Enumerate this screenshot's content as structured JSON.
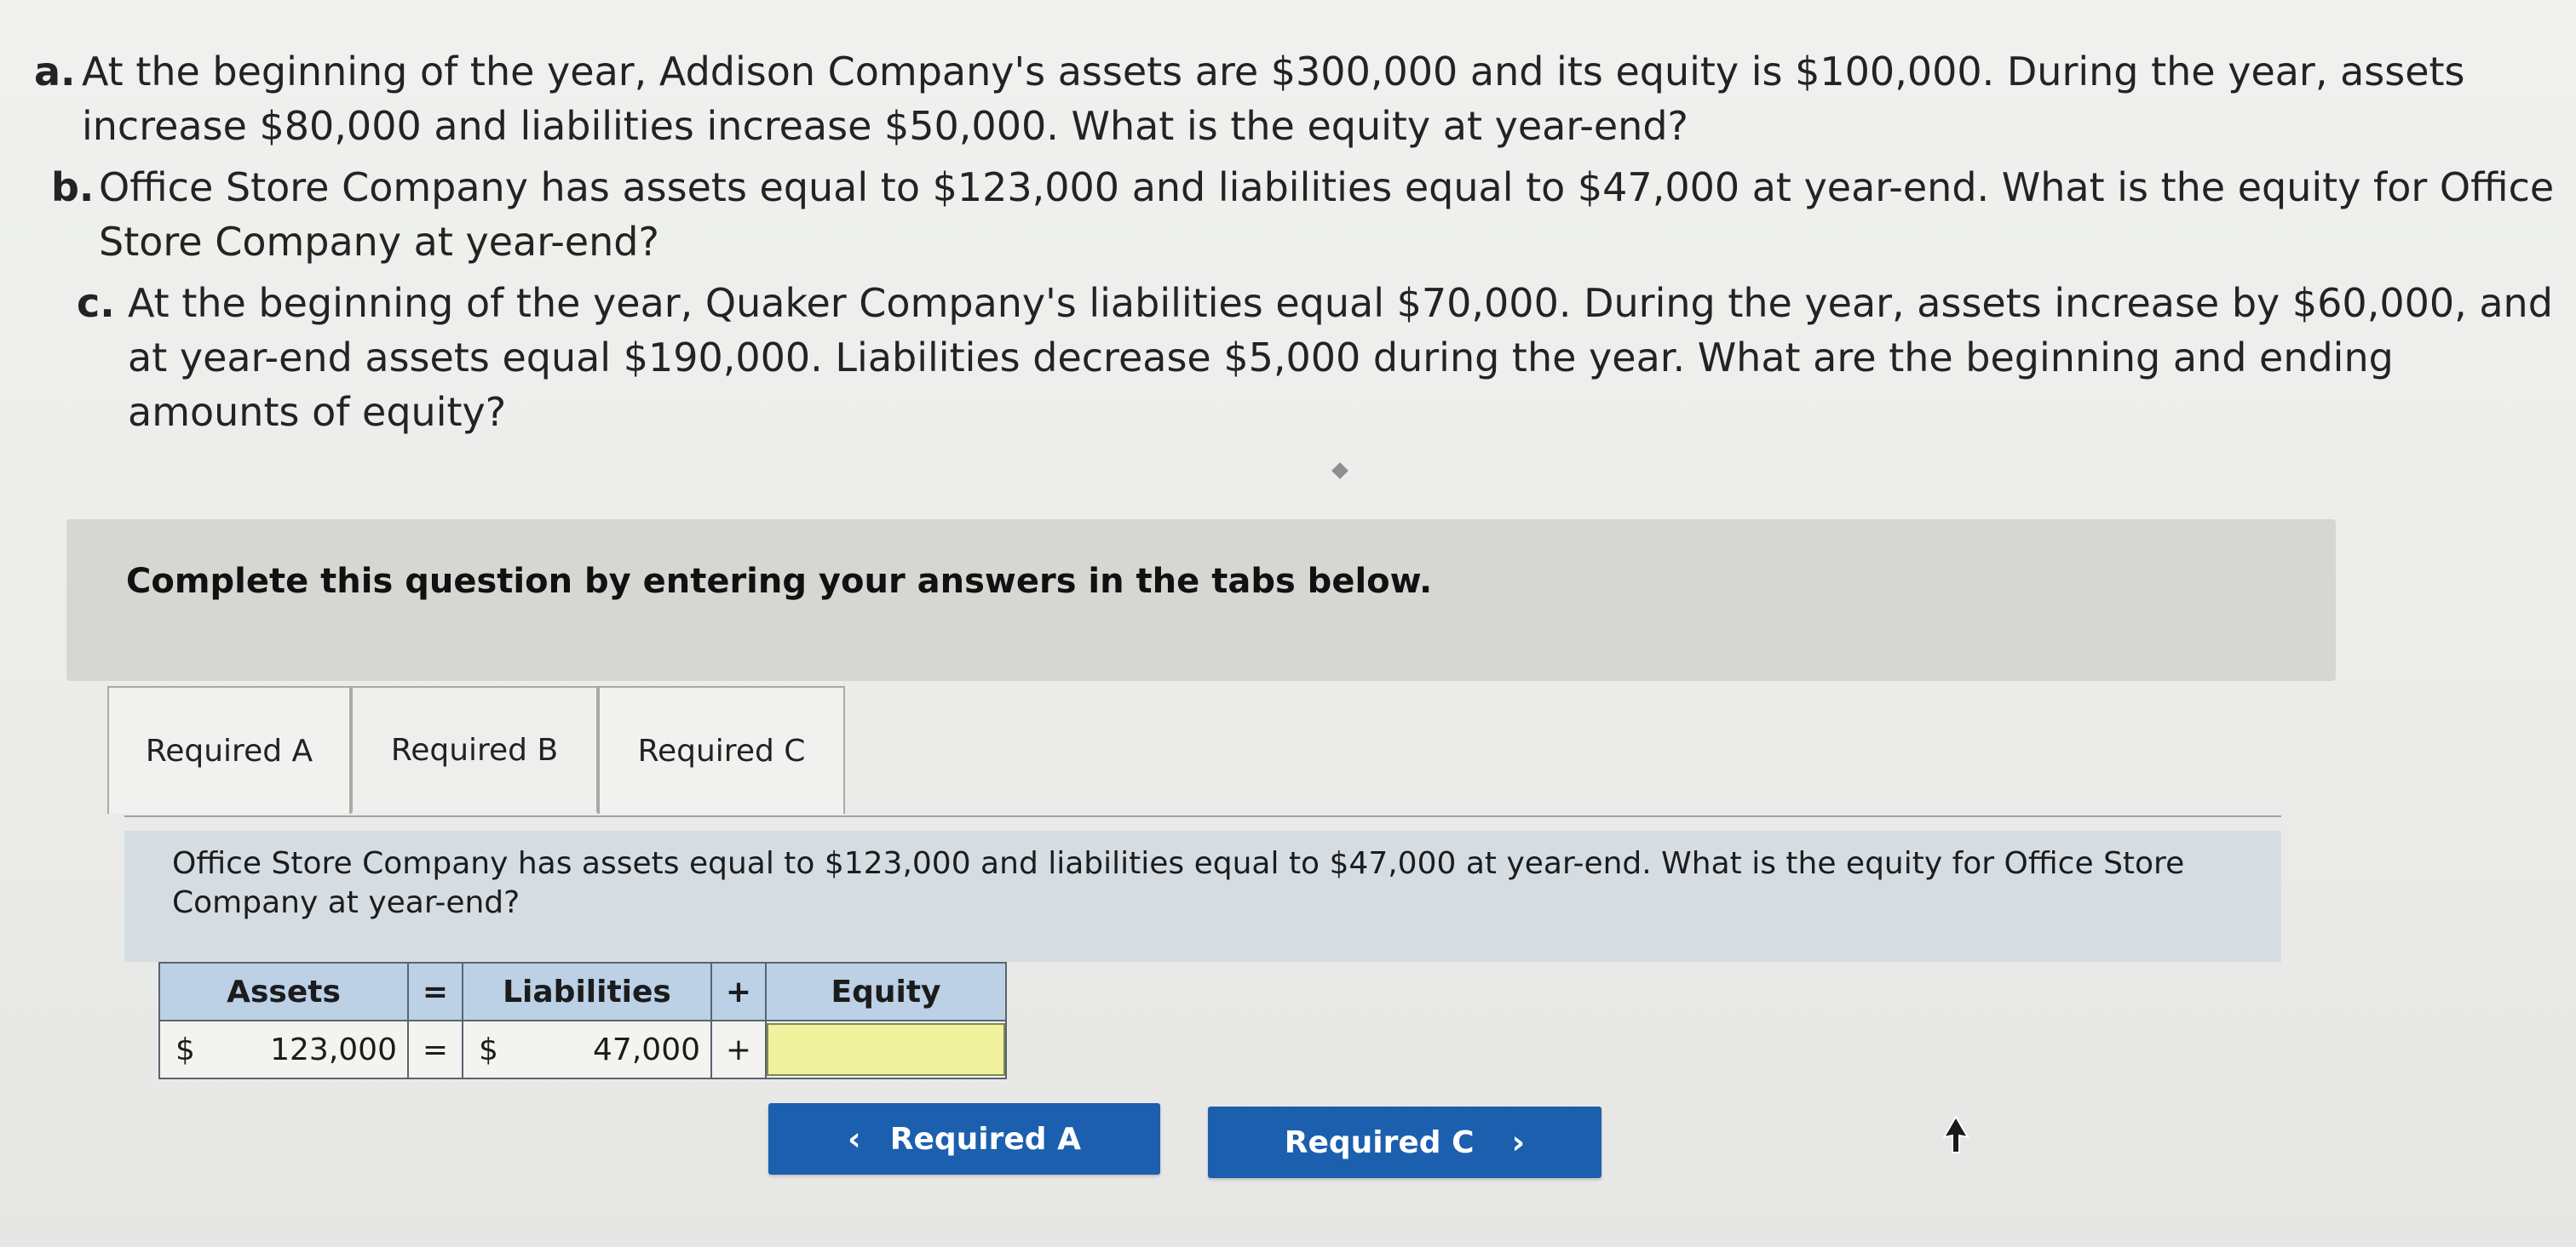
{
  "questions": [
    {
      "letter": "a.",
      "text": "At the beginning of the year, Addison Company's assets are $300,000 and its equity is $100,000. During the year, assets increase $80,000 and liabilities increase $50,000. What is the equity at year-end?"
    },
    {
      "letter": "b.",
      "text": "Office Store Company has assets equal to $123,000 and liabilities equal to $47,000 at year-end. What is the equity for Office Store Company at year-end?"
    },
    {
      "letter": "c.",
      "text": "At the beginning of the year, Quaker Company's liabilities equal $70,000. During the year, assets increase by $60,000, and at year-end assets equal $190,000. Liabilities decrease $5,000 during the year. What are the beginning and ending amounts of equity?"
    }
  ],
  "instruction": "Complete this question by entering your answers in the tabs below.",
  "tabs": [
    {
      "label": "Required A",
      "active": false
    },
    {
      "label": "Required B",
      "active": true
    },
    {
      "label": "Required C",
      "active": false
    }
  ],
  "panel_question": "Office Store Company has assets equal to $123,000 and liabilities equal to $47,000 at year-end. What is the equity for Office Store Company at year-end?",
  "table": {
    "headers": {
      "assets": "Assets",
      "eq_op": "=",
      "liabilities": "Liabilities",
      "plus_op": "+",
      "equity": "Equity"
    },
    "row": {
      "assets_currency": "$",
      "assets_value": "123,000",
      "eq_op": "=",
      "liabilities_currency": "$",
      "liabilities_value": "47,000",
      "plus_op": "+",
      "equity_value": ""
    }
  },
  "nav": {
    "prev_label": "Required A",
    "prev_icon": "‹",
    "next_label": "Required C",
    "next_icon": "›"
  },
  "colors": {
    "nav_button": "#1c5fae",
    "table_header": "#bcd0e6",
    "equity_input": "#f0f29e",
    "instruction_bar": "#d6d7d3",
    "question_panel": "#d6dde2"
  }
}
